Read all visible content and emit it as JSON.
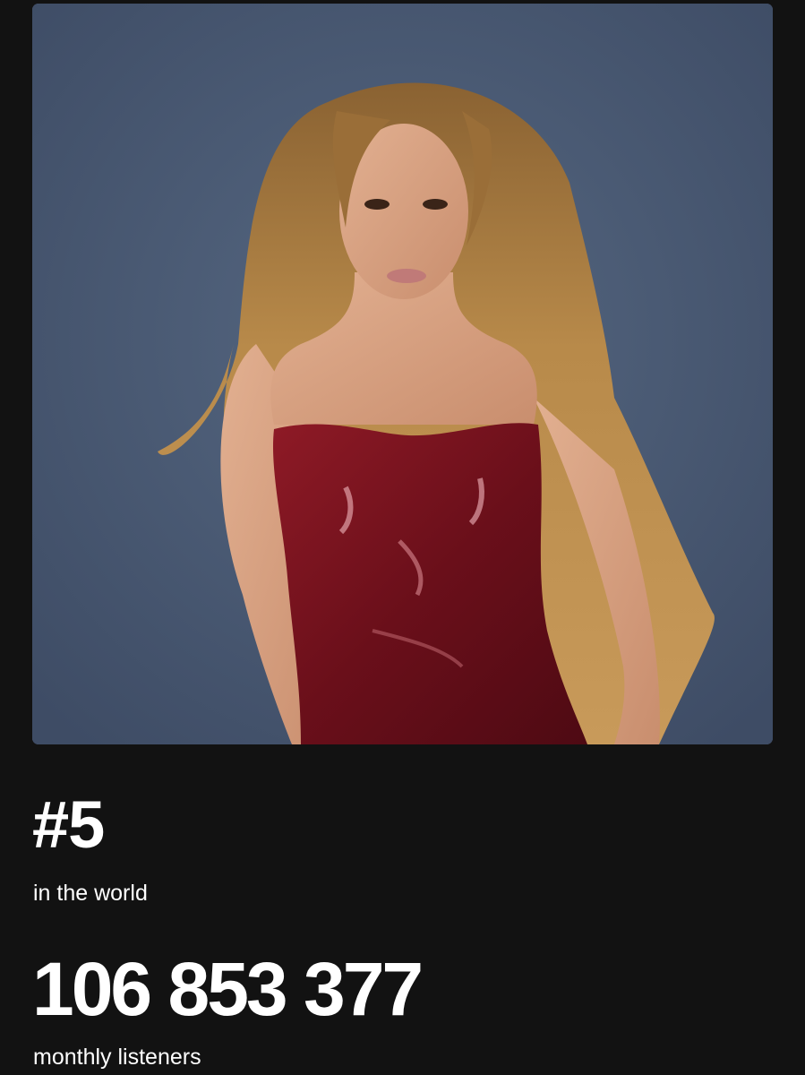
{
  "artist": {
    "photo_icon": "artist-portrait",
    "colors": {
      "backdrop": "#4a5a74",
      "hair": "#b88a4a",
      "skin": "#d9a384",
      "dress": "#7a1420",
      "page_background": "#121212"
    }
  },
  "stats": {
    "rank": "#5",
    "rank_caption": "in the world",
    "monthly_listeners": "106 853 377",
    "listeners_caption": "monthly listeners"
  }
}
